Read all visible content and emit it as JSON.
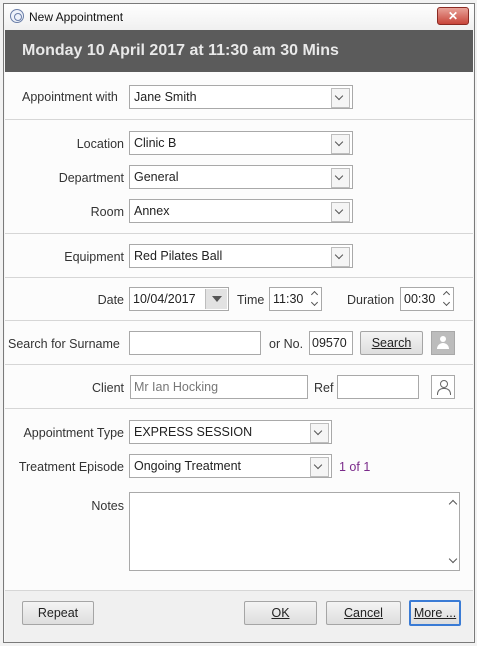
{
  "window": {
    "title": "New Appointment",
    "close_label": "✕"
  },
  "header": {
    "title": "Monday 10 April 2017 at 11:30 am 30 Mins"
  },
  "appointment_with": {
    "label": "Appointment with",
    "value": "Jane Smith"
  },
  "location": {
    "label": "Location",
    "value": "Clinic B"
  },
  "department": {
    "label": "Department",
    "value": "General"
  },
  "room": {
    "label": "Room",
    "value": "Annex"
  },
  "equipment": {
    "label": "Equipment",
    "value": "Red Pilates Ball"
  },
  "datetime": {
    "date_label": "Date",
    "date_value": "10/04/2017",
    "time_label": "Time",
    "time_value": "11:30",
    "duration_label": "Duration",
    "duration_value": "00:30"
  },
  "search": {
    "surname_label": "Search for Surname",
    "surname_value": "",
    "no_label": "or No.",
    "no_value": "09570",
    "button_label": "Search"
  },
  "client": {
    "label": "Client",
    "value": "Mr Ian Hocking",
    "ref_label": "Ref",
    "ref_value": ""
  },
  "appointment_type": {
    "label": "Appointment Type",
    "value": "EXPRESS SESSION"
  },
  "treatment_episode": {
    "label": "Treatment Episode",
    "value": "Ongoing Treatment",
    "count": "1 of 1",
    "count_color": "#7a2a8a"
  },
  "notes": {
    "label": "Notes",
    "value": ""
  },
  "footer": {
    "repeat": "Repeat",
    "ok": "OK",
    "cancel": "Cancel",
    "more": "More ..."
  }
}
